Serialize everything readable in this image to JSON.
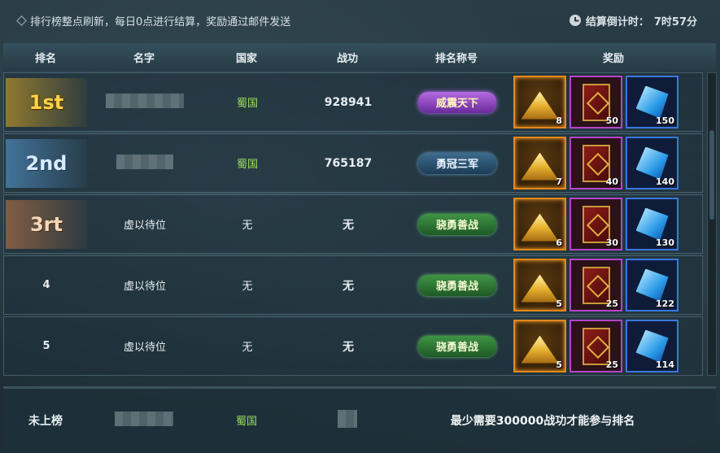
{
  "notice": {
    "text": "排行榜整点刷新，每日0点进行结算，奖励通过邮件发送",
    "timer_label": "结算倒计时：",
    "timer_value": "7时57分"
  },
  "columns": {
    "rank": "排名",
    "name": "名字",
    "country": "国家",
    "merit": "战功",
    "title": "排名称号",
    "reward": "奖励"
  },
  "rows": [
    {
      "rank": "1st",
      "name": "",
      "country": "蜀国",
      "merit": "928941",
      "title": "威震天下",
      "title_style": "purple",
      "rewards": [
        {
          "icon": "gold-pile-icon",
          "count": "8"
        },
        {
          "icon": "red-book-icon",
          "count": "50"
        },
        {
          "icon": "blue-gem-icon",
          "count": "150"
        }
      ]
    },
    {
      "rank": "2nd",
      "name": "",
      "country": "蜀国",
      "merit": "765187",
      "title": "勇冠三军",
      "title_style": "blue",
      "rewards": [
        {
          "icon": "gold-pile-icon",
          "count": "7"
        },
        {
          "icon": "red-book-icon",
          "count": "40"
        },
        {
          "icon": "blue-gem-icon",
          "count": "140"
        }
      ]
    },
    {
      "rank": "3rt",
      "name": "虚以待位",
      "country": "无",
      "merit": "无",
      "title": "骁勇善战",
      "title_style": "green",
      "rewards": [
        {
          "icon": "gold-pile-icon",
          "count": "6"
        },
        {
          "icon": "red-book-icon",
          "count": "30"
        },
        {
          "icon": "blue-gem-icon",
          "count": "130"
        }
      ]
    },
    {
      "rank": "4",
      "name": "虚以待位",
      "country": "无",
      "merit": "无",
      "title": "骁勇善战",
      "title_style": "green",
      "rewards": [
        {
          "icon": "gold-pile-icon",
          "count": "5"
        },
        {
          "icon": "red-book-icon",
          "count": "25"
        },
        {
          "icon": "blue-gem-icon",
          "count": "122"
        }
      ]
    },
    {
      "rank": "5",
      "name": "虚以待位",
      "country": "无",
      "merit": "无",
      "title": "骁勇善战",
      "title_style": "green",
      "rewards": [
        {
          "icon": "gold-pile-icon",
          "count": "5"
        },
        {
          "icon": "red-book-icon",
          "count": "25"
        },
        {
          "icon": "blue-gem-icon",
          "count": "114"
        }
      ]
    }
  ],
  "my_row": {
    "rank": "未上榜",
    "country": "蜀国",
    "tip": "最少需要300000战功才能参与排名"
  },
  "colors": {
    "shu_green": "#9be05a",
    "gold_border": "#e08a1c",
    "book_border": "#b446c6",
    "gem_border": "#3a78e0"
  }
}
